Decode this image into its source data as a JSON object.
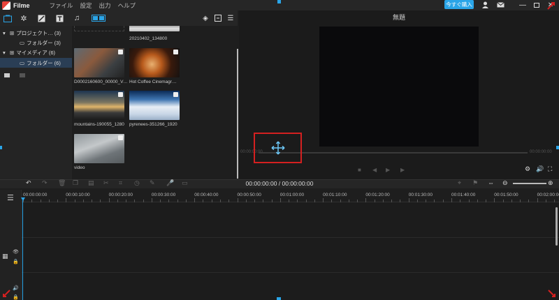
{
  "app": {
    "name": "Filme"
  },
  "menu": [
    "ファイル",
    "設定",
    "出力",
    "ヘルプ"
  ],
  "header": {
    "buy_label": "今すぐ購入"
  },
  "tree": [
    {
      "label": "プロジェクト… (3)"
    },
    {
      "label": "フォルダー (3)"
    },
    {
      "label": "マイメディア (6)"
    },
    {
      "label": "フォルダー (6)"
    }
  ],
  "media": [
    {
      "name": "20210402_134800"
    },
    {
      "name": "D0002160600_00000_V…"
    },
    {
      "name": "Hot Coffee Cinemagr…"
    },
    {
      "name": "mountains-190055_1280"
    },
    {
      "name": "pyrenees-351266_1920"
    },
    {
      "name": "video"
    }
  ],
  "preview": {
    "title": "無題",
    "time_left": "00:00:00:00",
    "time_right": "00:00:00:00"
  },
  "timeline": {
    "timecode": "00:00:00:00 / 00:00:00:00",
    "ticks": [
      "00:00:00:00",
      "00:00:10:00",
      "00:00:20:00",
      "00:00:30:00",
      "00:00:40:00",
      "00:00:50:00",
      "00:01:00:00",
      "00:01:10:00",
      "00:01:20:00",
      "00:01:30:00",
      "00:01:40:00",
      "00:01:50:00",
      "00:02:00:00"
    ]
  },
  "colors": {
    "accent": "#2aa5e8",
    "highlight_box": "#d42020",
    "selected_row": "#2a3e55"
  }
}
